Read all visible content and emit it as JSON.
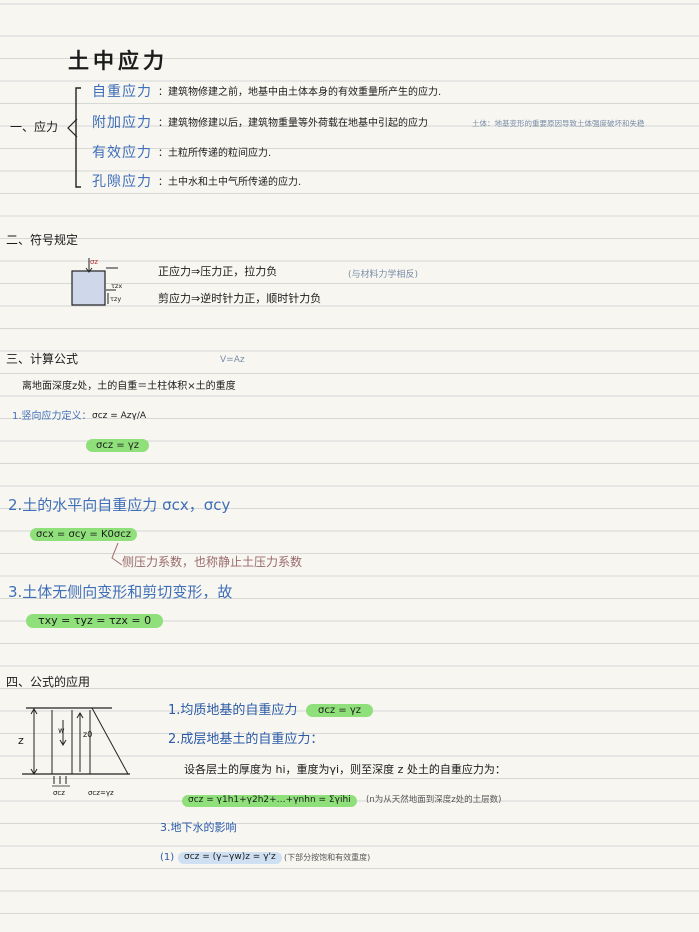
{
  "title": "土中应力",
  "s1": {
    "label": "一、应力",
    "items": [
      {
        "term": "自重应力",
        "desc": "：建筑物修建之前，地基中由土体本身的有效重量所产生的应力."
      },
      {
        "term": "附加应力",
        "desc": "：建筑物修建以后，建筑物重量等外荷载在地基中引起的应力",
        "note": "土体：地基变形的重要原因导致土体强度破坏和失稳"
      },
      {
        "term": "有效应力",
        "desc": "：土粒所传递的粒间应力."
      },
      {
        "term": "孔隙应力",
        "desc": "：土中水和土中气所传递的应力."
      }
    ]
  },
  "s2": {
    "heading": "二、符号规定",
    "rules": [
      "正应力⇒压力正，拉力负",
      "剪应力⇒逆时针力正，顺时针力负"
    ],
    "note": "(与材料力学相反)",
    "sym_szz": "σz",
    "sym_tzx": "τzx",
    "sym_tzy": "τzy"
  },
  "s3": {
    "heading": "三、计算公式",
    "v_note": "V=Az",
    "intro": "离地面深度z处，土的自重＝土柱体积×土的重度",
    "item1_label": "1.竖向应力定义：",
    "item1_formula": "σcz = Azγ/A",
    "item1_result": "σcz = γz",
    "item2": "2.土的水平向自重应力 σcx，σcy",
    "item2_formula": "σcx = σcy = K0σcz",
    "item2_note": "侧压力系数，也称静止土压力系数",
    "item3": "3.土体无侧向变形和剪切变形，故",
    "item3_formula": "τxy = τyz = τzx = 0"
  },
  "s4": {
    "heading": "四、公式的应用",
    "diag_z": "z",
    "diag_w": "w",
    "diag_z0": "z0",
    "diag_scz": "σcz",
    "diag_gz": "σcz=γz",
    "item1": "1.均质地基的自重应力",
    "item1_formula": "σcz = γz",
    "item2": "2.成层地基土的自重应力：",
    "item2_text": "设各层土的厚度为 hi，重度为γi，则至深度 z 处土的自重应力为：",
    "item2_formula": "σcz = γ1h1+γ2h2+…+γnhn = Σγihi",
    "item2_note": "(n为从天然地面到深度z处的土层数)",
    "item3": "3.地下水的影响",
    "item3_sub": "(1)",
    "item3_formula": "σcz = (γ−γw)z = γ'z",
    "item3_note": "(下部分按饱和有效重度)"
  }
}
